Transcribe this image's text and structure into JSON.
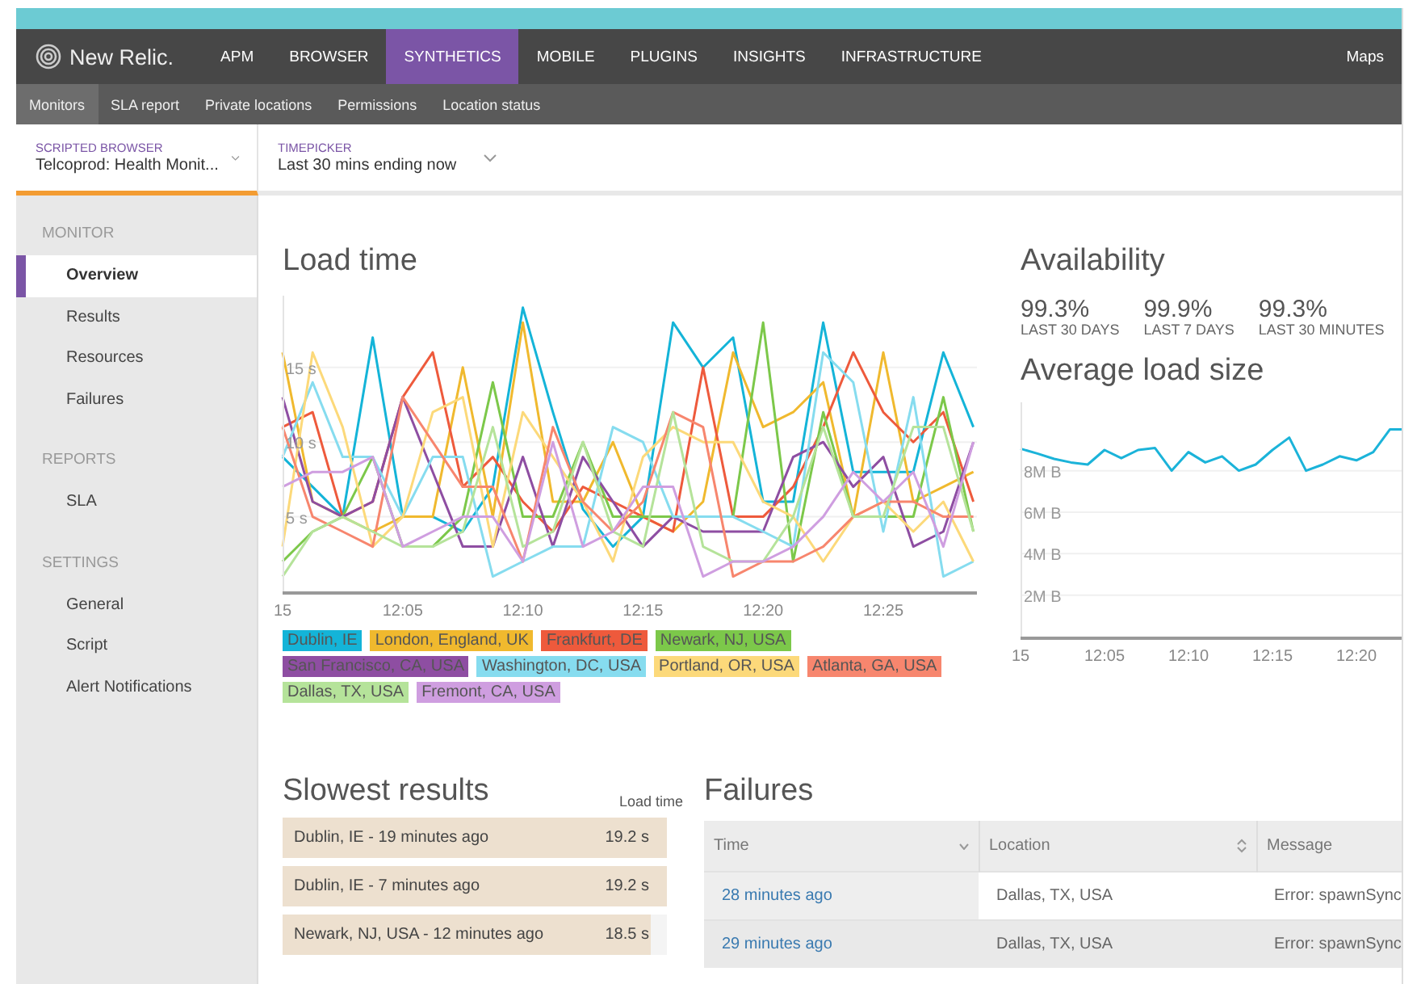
{
  "top_nav": {
    "logo": "New Relic.",
    "items": [
      {
        "label": "APM",
        "selected": false
      },
      {
        "label": "BROWSER",
        "selected": false
      },
      {
        "label": "SYNTHETICS",
        "selected": true
      },
      {
        "label": "MOBILE",
        "selected": false
      },
      {
        "label": "PLUGINS",
        "selected": false
      },
      {
        "label": "INSIGHTS",
        "selected": false
      },
      {
        "label": "INFRASTRUCTURE",
        "selected": false
      }
    ],
    "right_link": "Maps"
  },
  "sub_nav": {
    "items": [
      {
        "label": "Monitors",
        "selected": true
      },
      {
        "label": "SLA report",
        "selected": false
      },
      {
        "label": "Private locations",
        "selected": false
      },
      {
        "label": "Permissions",
        "selected": false
      },
      {
        "label": "Location status",
        "selected": false
      }
    ]
  },
  "monitor_picker": {
    "label": "SCRIPTED BROWSER",
    "value": "Telcoprod: Health Monit..."
  },
  "timepicker": {
    "label": "TIMEPICKER",
    "value": "Last 30 mins ending now"
  },
  "sidebar": {
    "sections": [
      {
        "title": "MONITOR",
        "items": [
          {
            "label": "Overview",
            "selected": true
          },
          {
            "label": "Results",
            "selected": false
          },
          {
            "label": "Resources",
            "selected": false
          },
          {
            "label": "Failures",
            "selected": false
          }
        ]
      },
      {
        "title": "REPORTS",
        "items": [
          {
            "label": "SLA",
            "selected": false
          }
        ]
      },
      {
        "title": "SETTINGS",
        "items": [
          {
            "label": "General",
            "selected": false
          },
          {
            "label": "Script",
            "selected": false
          },
          {
            "label": "Alert Notifications",
            "selected": false
          }
        ]
      }
    ]
  },
  "load_time": {
    "title": "Load time",
    "chart_data": {
      "type": "line",
      "categories": [
        "15",
        null,
        null,
        null,
        "12:05",
        null,
        null,
        null,
        "12:10",
        null,
        null,
        null,
        "12:15",
        null,
        null,
        null,
        "12:20",
        null,
        null,
        null,
        "12:25",
        null,
        null,
        null
      ],
      "ylim": [
        0,
        19.8
      ],
      "grid": true,
      "yticks": [
        {
          "value": 5,
          "label": "5 s"
        },
        {
          "value": 10,
          "label": "10 s"
        },
        {
          "value": 15,
          "label": "15 s"
        }
      ],
      "series": [
        {
          "name": "Dublin, IE",
          "color": "#14b4d8",
          "values": [
            9,
            7,
            5,
            17,
            5,
            5,
            4,
            7,
            19,
            12,
            5.5,
            3,
            5,
            18,
            15,
            17,
            6,
            6,
            18,
            8,
            8,
            8,
            16,
            11
          ]
        },
        {
          "name": "London, England, UK",
          "color": "#f0b92e",
          "values": [
            16,
            6,
            5,
            4,
            5,
            5,
            15,
            5,
            18,
            6,
            6,
            10,
            5,
            4,
            6,
            16,
            11,
            12,
            14,
            5,
            16,
            6,
            7,
            8
          ]
        },
        {
          "name": "Frankfurt, DE",
          "color": "#ee5a3c",
          "values": [
            11,
            12,
            5,
            6,
            13,
            16,
            7,
            9,
            6,
            4,
            7,
            6,
            5,
            4,
            15,
            5,
            5,
            7,
            11,
            16,
            12,
            10,
            12,
            6
          ]
        },
        {
          "name": "Newark, NJ, USA",
          "color": "#7cc84a",
          "values": [
            2,
            4,
            5,
            9,
            3,
            3,
            5,
            14,
            5,
            5,
            10,
            5,
            5,
            5,
            5,
            5,
            18,
            2,
            12,
            5,
            5,
            5,
            13,
            4
          ]
        },
        {
          "name": "San Francisco, CA, USA",
          "color": "#8e4ea2",
          "values": [
            13,
            6,
            5,
            6,
            13,
            8,
            3,
            3,
            9,
            3,
            9,
            6,
            3,
            5,
            4,
            4,
            4,
            9,
            10,
            7,
            9,
            3,
            4,
            10
          ]
        },
        {
          "name": "Washington, DC, USA",
          "color": "#86dcef",
          "values": [
            9,
            14,
            9,
            9,
            5,
            9,
            9,
            1,
            2,
            3,
            3,
            11,
            10,
            5,
            5,
            5,
            4,
            3,
            16,
            14,
            4,
            13,
            1,
            2
          ]
        },
        {
          "name": "Portland, OR, USA",
          "color": "#fcd97a",
          "values": [
            3,
            16,
            11,
            3,
            5,
            12,
            13,
            3,
            12,
            9,
            6,
            2,
            9,
            11,
            10,
            10,
            6,
            5,
            2,
            5,
            6,
            4,
            6,
            2
          ]
        },
        {
          "name": "Atlanta, GA, USA",
          "color": "#f7866e",
          "values": [
            11,
            5,
            4,
            3,
            13,
            10,
            7,
            7,
            2,
            11,
            6,
            4,
            6,
            12,
            11,
            1,
            2,
            2,
            3,
            5,
            6,
            6,
            5,
            5
          ]
        },
        {
          "name": "Dallas, TX, USA",
          "color": "#b5e39a",
          "values": [
            1,
            4,
            5,
            4,
            3,
            3,
            4,
            11,
            3,
            4,
            10,
            4,
            3,
            12,
            3,
            2,
            2,
            5,
            11,
            5,
            5,
            11,
            11,
            4
          ]
        },
        {
          "name": "Fremont, CA, USA",
          "color": "#cf9ee0",
          "values": [
            7,
            8,
            8,
            9,
            3,
            4,
            5,
            5,
            2,
            10,
            3,
            4,
            7,
            7,
            1,
            2,
            2,
            3,
            5,
            8,
            6,
            8,
            3,
            10
          ]
        }
      ]
    }
  },
  "availability": {
    "title": "Availability",
    "stats": [
      {
        "value": "99.3%",
        "label": "LAST 30 DAYS"
      },
      {
        "value": "99.9%",
        "label": "LAST 7 DAYS"
      },
      {
        "value": "99.3%",
        "label": "LAST 30 MINUTES"
      }
    ]
  },
  "average_load_size": {
    "title": "Average load size",
    "chart_data": {
      "type": "line",
      "categories": [
        "15",
        null,
        null,
        null,
        null,
        "12:05",
        null,
        null,
        null,
        null,
        "12:10",
        null,
        null,
        null,
        null,
        "12:15",
        null,
        null,
        null,
        null,
        "12:20",
        null,
        null,
        null
      ],
      "ylim": [
        0,
        11.3
      ],
      "grid": true,
      "yticks": [
        {
          "value": 2,
          "label": "2M B"
        },
        {
          "value": 4,
          "label": "4M B"
        },
        {
          "value": 6,
          "label": "6M B"
        },
        {
          "value": 8,
          "label": "8M B"
        }
      ],
      "series": [
        {
          "color": "#1bb3d9",
          "values": [
            9.06,
            8.83,
            8.57,
            8.4,
            8.3,
            9.0,
            8.6,
            9.0,
            9.1,
            8.0,
            8.9,
            8.4,
            8.7,
            8.0,
            8.3,
            9.0,
            9.6,
            8.0,
            8.3,
            8.7,
            8.5,
            8.9,
            10.0,
            10.0
          ]
        }
      ]
    }
  },
  "slowest_results": {
    "title": "Slowest results",
    "column_label": "Load time",
    "rows": [
      {
        "label": "Dublin, IE - 19 minutes ago",
        "value": "19.2 s",
        "level": 1
      },
      {
        "label": "Dublin, IE - 7 minutes ago",
        "value": "19.2 s",
        "level": 1
      },
      {
        "label": "Newark, NJ, USA - 12 minutes ago",
        "value": "18.5 s",
        "level": 0.96
      }
    ]
  },
  "failures": {
    "title": "Failures",
    "columns": [
      {
        "label": "Time",
        "kind": "sorted"
      },
      {
        "label": "Location",
        "kind": "sortable"
      },
      {
        "label": "Message",
        "kind": "plain"
      }
    ],
    "rows": [
      {
        "highlighted": false,
        "cells": [
          "28 minutes ago",
          "Dallas, TX, USA",
          "Error: spawnSync"
        ]
      },
      {
        "highlighted": true,
        "cells": [
          "29 minutes ago",
          "Dallas, TX, USA",
          "Error: spawnSync"
        ]
      }
    ]
  }
}
